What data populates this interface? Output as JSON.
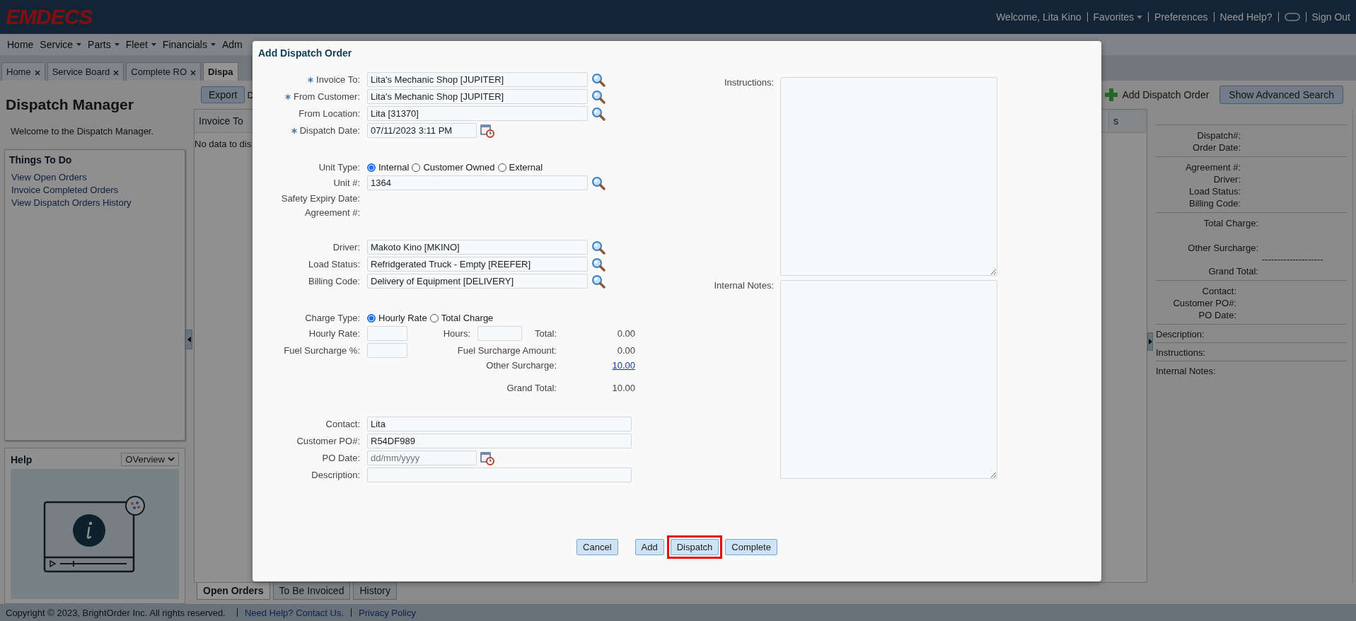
{
  "header": {
    "logo": "EMDECS",
    "welcome": "Welcome, Lita Kino",
    "links": [
      {
        "kind": "dropdown",
        "label": "Favorites"
      },
      {
        "kind": "link",
        "label": "Preferences"
      },
      {
        "kind": "link",
        "label": "Need Help?"
      },
      {
        "kind": "toggle"
      },
      {
        "kind": "link",
        "label": "Sign Out"
      }
    ]
  },
  "menu": [
    {
      "label": "Home",
      "has_menu": false
    },
    {
      "label": "Service",
      "has_menu": true
    },
    {
      "label": "Parts",
      "has_menu": true
    },
    {
      "label": "Fleet",
      "has_menu": true
    },
    {
      "label": "Financials",
      "has_menu": true
    },
    {
      "label": "Adm",
      "has_menu": false
    }
  ],
  "tabs": [
    {
      "label": "Home",
      "selected": false,
      "closable": true
    },
    {
      "label": "Service Board",
      "selected": false,
      "closable": true
    },
    {
      "label": "Complete RO",
      "selected": false,
      "closable": true
    },
    {
      "label": "Dispa",
      "selected": true,
      "closable": false
    }
  ],
  "sidebar": {
    "title": "Dispatch Manager",
    "welcome": "Welcome to the Dispatch Manager.",
    "todo": {
      "title": "Things To Do",
      "links": [
        "View Open Orders",
        "Invoice Completed Orders",
        "View Dispatch Orders History"
      ]
    },
    "help": {
      "title": "Help",
      "select": "OVerview"
    }
  },
  "grid": {
    "export": "Export",
    "toolbar_cut": "D",
    "column_1": "Invoice To",
    "empty": "No data to dis",
    "column_cut": "s",
    "add": "Add Dispatch Order",
    "advanced": "Show Advanced Search",
    "bottom_tabs": [
      {
        "label": "Open Orders",
        "selected": true
      },
      {
        "label": "To Be Invoiced",
        "selected": false
      },
      {
        "label": "History",
        "selected": false
      }
    ]
  },
  "details": {
    "sections": [
      {
        "kind": "pairs",
        "rows": [
          "Dispatch#:",
          "Order Date:"
        ]
      },
      {
        "kind": "pairs",
        "rows": [
          "Agreement #:",
          "Driver:",
          "Load Status:",
          "Billing Code:"
        ]
      },
      {
        "kind": "totals",
        "rows": [
          "Total Charge:",
          "Other Surcharge:",
          "Grand Total:"
        ],
        "rule": "--------------------"
      },
      {
        "kind": "contact",
        "rows": [
          "Contact:",
          "Customer PO#:",
          "PO Date:"
        ]
      },
      {
        "kind": "notes",
        "rows": [
          "Description:"
        ]
      },
      {
        "kind": "notes",
        "rows": [
          "Instructions:"
        ]
      },
      {
        "kind": "notes",
        "rows": [
          "Internal Notes:"
        ]
      }
    ]
  },
  "footer": {
    "copyright": "Copyright © 2023, BrightOrder Inc. All rights reserved.",
    "links": [
      "Need Help? Contact Us.",
      "Privacy Policy"
    ]
  },
  "dialog": {
    "title": "Add Dispatch Order",
    "sections": [
      [
        {
          "kind": "lookup",
          "label": "Invoice To:",
          "required": true,
          "value": "Lita's Mechanic Shop [JUPITER]"
        },
        {
          "kind": "lookup",
          "label": "From Customer:",
          "required": true,
          "value": "Lita's Mechanic Shop [JUPITER]"
        },
        {
          "kind": "lookup",
          "label": "From Location:",
          "required": false,
          "value": "Lita [31370]"
        },
        {
          "kind": "date",
          "label": "Dispatch Date:",
          "required": true,
          "value": "07/11/2023 3:11 PM"
        }
      ],
      [
        {
          "kind": "radio",
          "label": "Unit Type:",
          "options": [
            {
              "label": "Internal",
              "selected": true
            },
            {
              "label": "Customer Owned",
              "selected": false
            },
            {
              "label": "External",
              "selected": false
            }
          ]
        },
        {
          "kind": "lookup",
          "label": "Unit #:",
          "required": false,
          "value": "1364"
        },
        {
          "kind": "label",
          "label": "Safety Expiry Date:"
        },
        {
          "kind": "label",
          "label": "Agreement #:"
        }
      ],
      [
        {
          "kind": "lookup",
          "label": "Driver:",
          "required": false,
          "value": "Makoto Kino [MKINO]"
        },
        {
          "kind": "lookup",
          "label": "Load Status:",
          "required": false,
          "value": "Refridgerated Truck - Empty [REEFER]"
        },
        {
          "kind": "lookup",
          "label": "Billing Code:",
          "required": false,
          "value": "Delivery of Equipment [DELIVERY]"
        }
      ],
      [
        {
          "kind": "radio",
          "label": "Charge Type:",
          "options": [
            {
              "label": "Hourly Rate",
              "selected": true
            },
            {
              "label": "Total Charge",
              "selected": false
            }
          ]
        },
        {
          "kind": "charges",
          "hourly_rate": "Hourly Rate:",
          "hours": "Hours:",
          "fuel": "Fuel Surcharge %:",
          "total": {
            "label": "Total:",
            "value": "0.00"
          },
          "fuel_amount": {
            "label": "Fuel Surcharge Amount:",
            "value": "0.00"
          },
          "other": {
            "label": "Other Surcharge:",
            "value": "10.00"
          },
          "grand": {
            "label": "Grand Total:",
            "value": "10.00"
          }
        }
      ],
      [
        {
          "kind": "wide",
          "label": "Contact:",
          "value": "Lita"
        },
        {
          "kind": "wide",
          "label": "Customer PO#:",
          "value": "R54DF989"
        },
        {
          "kind": "date",
          "label": "PO Date:",
          "required": false,
          "placeholder": "dd/mm/yyyy"
        },
        {
          "kind": "wide",
          "label": "Description:"
        }
      ]
    ],
    "notes": [
      "Instructions:",
      "Internal Notes:"
    ],
    "buttons": [
      {
        "label": "Cancel",
        "highlighted": false
      },
      {
        "label": "Add",
        "highlighted": false
      },
      {
        "label": "Dispatch",
        "highlighted": true
      },
      {
        "label": "Complete",
        "highlighted": false
      }
    ]
  }
}
